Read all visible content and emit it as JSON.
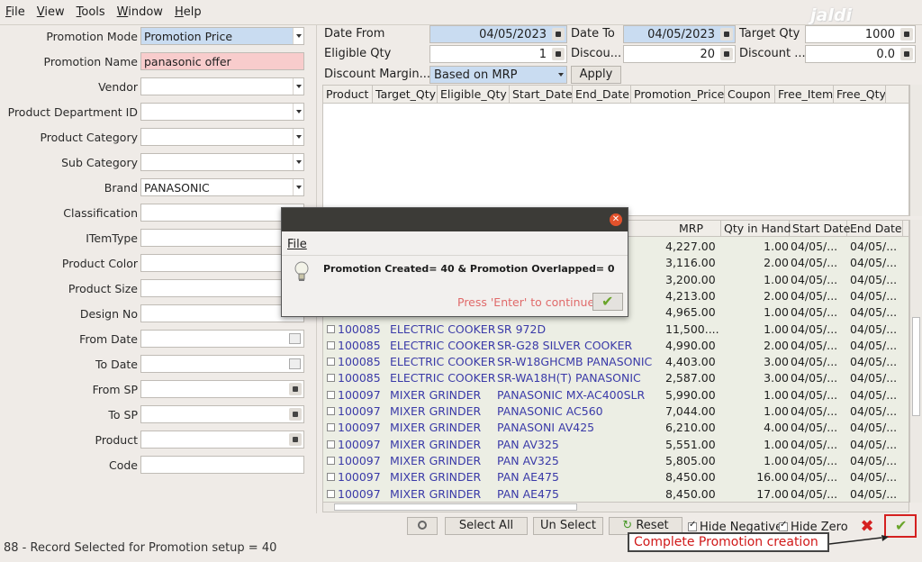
{
  "menu": {
    "file": "File",
    "view": "View",
    "tools": "Tools",
    "window": "Window",
    "help": "Help"
  },
  "logo": "jaldi",
  "left_form": [
    {
      "label": "Promotion Mode",
      "value": "Promotion Price",
      "style": "blue",
      "ctl": "dd"
    },
    {
      "label": "Promotion Name",
      "value": "panasonic offer",
      "style": "pink",
      "ctl": ""
    },
    {
      "label": "Vendor",
      "value": "",
      "style": "",
      "ctl": "dd"
    },
    {
      "label": "Product Department ID",
      "value": "",
      "style": "",
      "ctl": "dd"
    },
    {
      "label": "Product Category",
      "value": "",
      "style": "",
      "ctl": "dd"
    },
    {
      "label": "Sub Category",
      "value": "",
      "style": "",
      "ctl": "dd"
    },
    {
      "label": "Brand",
      "value": "PANASONIC",
      "style": "",
      "ctl": "dd"
    },
    {
      "label": "Classification",
      "value": "",
      "style": "",
      "ctl": ""
    },
    {
      "label": "ITemType",
      "value": "",
      "style": "",
      "ctl": ""
    },
    {
      "label": "Product Color",
      "value": "",
      "style": "",
      "ctl": ""
    },
    {
      "label": "Product Size",
      "value": "",
      "style": "",
      "ctl": ""
    },
    {
      "label": "Design No",
      "value": "",
      "style": "",
      "ctl": ""
    },
    {
      "label": "From Date",
      "value": "",
      "style": "",
      "ctl": "cal"
    },
    {
      "label": "To Date",
      "value": "",
      "style": "",
      "ctl": "cal"
    },
    {
      "label": "From SP",
      "value": "",
      "style": "",
      "ctl": "spin"
    },
    {
      "label": "To SP",
      "value": "",
      "style": "",
      "ctl": "spin"
    },
    {
      "label": "Product",
      "value": "",
      "style": "",
      "ctl": "spin"
    },
    {
      "label": "Code",
      "value": "",
      "style": "",
      "ctl": ""
    }
  ],
  "top": {
    "date_from_label": "Date From",
    "date_from": "04/05/2023",
    "date_to_label": "Date To",
    "date_to": "04/05/2023",
    "target_qty_label": "Target Qty",
    "target_qty": "1000",
    "eligible_qty_label": "Eligible Qty",
    "eligible_qty": "1",
    "discount_label": "Discou...",
    "discount": "20",
    "discount2_label": "Discount ...",
    "discount2": "0.0",
    "margin_label": "Discount Margin...",
    "margin_value": "Based on MRP",
    "apply": "Apply"
  },
  "grid1_columns": [
    "Product",
    "Target_Qty",
    "Eligible_Qty",
    "Start_Date",
    "End_Date",
    "Promotion_Price",
    "Coupon",
    "Free_Item",
    "Free_Qty"
  ],
  "grid2_columns": [
    "MRP",
    "Qty in Hand",
    "Start Date",
    "End Date"
  ],
  "grid2_rows": [
    {
      "code": "",
      "cat": "",
      "name": "",
      "mrp": "4,227.00",
      "qty": "1.00",
      "start": "04/05/...",
      "end": "04/05/..."
    },
    {
      "code": "",
      "cat": "",
      "name": "",
      "mrp": "3,116.00",
      "qty": "2.00",
      "start": "04/05/...",
      "end": "04/05/..."
    },
    {
      "code": "",
      "cat": "",
      "name": "",
      "mrp": "3,200.00",
      "qty": "1.00",
      "start": "04/05/...",
      "end": "04/05/..."
    },
    {
      "code": "",
      "cat": "",
      "name": "",
      "mrp": "4,213.00",
      "qty": "2.00",
      "start": "04/05/...",
      "end": "04/05/..."
    },
    {
      "code": "",
      "cat": "",
      "name": "",
      "mrp": "4,965.00",
      "qty": "1.00",
      "start": "04/05/...",
      "end": "04/05/..."
    },
    {
      "code": "100085",
      "cat": "ELECTRIC COOKER",
      "name": "SR 972D",
      "mrp": "11,500....",
      "qty": "1.00",
      "start": "04/05/...",
      "end": "04/05/..."
    },
    {
      "code": "100085",
      "cat": "ELECTRIC COOKER",
      "name": "SR-G28 SILVER COOKER",
      "mrp": "4,990.00",
      "qty": "2.00",
      "start": "04/05/...",
      "end": "04/05/..."
    },
    {
      "code": "100085",
      "cat": "ELECTRIC COOKER",
      "name": "SR-W18GHCMB PANASONIC",
      "mrp": "4,403.00",
      "qty": "3.00",
      "start": "04/05/...",
      "end": "04/05/..."
    },
    {
      "code": "100085",
      "cat": "ELECTRIC COOKER",
      "name": "SR-WA18H(T) PANASONIC",
      "mrp": "2,587.00",
      "qty": "3.00",
      "start": "04/05/...",
      "end": "04/05/..."
    },
    {
      "code": "100097",
      "cat": "MIXER GRINDER",
      "name": "PANASONIC MX-AC400SLR",
      "mrp": "5,990.00",
      "qty": "1.00",
      "start": "04/05/...",
      "end": "04/05/..."
    },
    {
      "code": "100097",
      "cat": "MIXER GRINDER",
      "name": "PANASONIC AC560",
      "mrp": "7,044.00",
      "qty": "1.00",
      "start": "04/05/...",
      "end": "04/05/..."
    },
    {
      "code": "100097",
      "cat": "MIXER GRINDER",
      "name": "PANASONI AV425",
      "mrp": "6,210.00",
      "qty": "4.00",
      "start": "04/05/...",
      "end": "04/05/..."
    },
    {
      "code": "100097",
      "cat": "MIXER GRINDER",
      "name": "PAN AV325",
      "mrp": "5,551.00",
      "qty": "1.00",
      "start": "04/05/...",
      "end": "04/05/..."
    },
    {
      "code": "100097",
      "cat": "MIXER GRINDER",
      "name": "PAN AV325",
      "mrp": "5,805.00",
      "qty": "1.00",
      "start": "04/05/...",
      "end": "04/05/..."
    },
    {
      "code": "100097",
      "cat": "MIXER GRINDER",
      "name": "PAN AE475",
      "mrp": "8,450.00",
      "qty": "16.00",
      "start": "04/05/...",
      "end": "04/05/..."
    },
    {
      "code": "100097",
      "cat": "MIXER GRINDER",
      "name": "PAN AE475",
      "mrp": "8,450.00",
      "qty": "17.00",
      "start": "04/05/...",
      "end": "04/05/..."
    }
  ],
  "bottom": {
    "select_all": "Select All",
    "unselect": "Un Select",
    "reset": "Reset",
    "hide_negative": "Hide Negative",
    "hide_zero": "Hide Zero"
  },
  "status": "88 - Record Selected for Promotion setup = 40",
  "annotation": "Complete Promotion creation",
  "dialog": {
    "menu": "File",
    "message": "Promotion Created= 40 & Promotion Overlapped= 0",
    "enter": "Press 'Enter' to continue"
  }
}
